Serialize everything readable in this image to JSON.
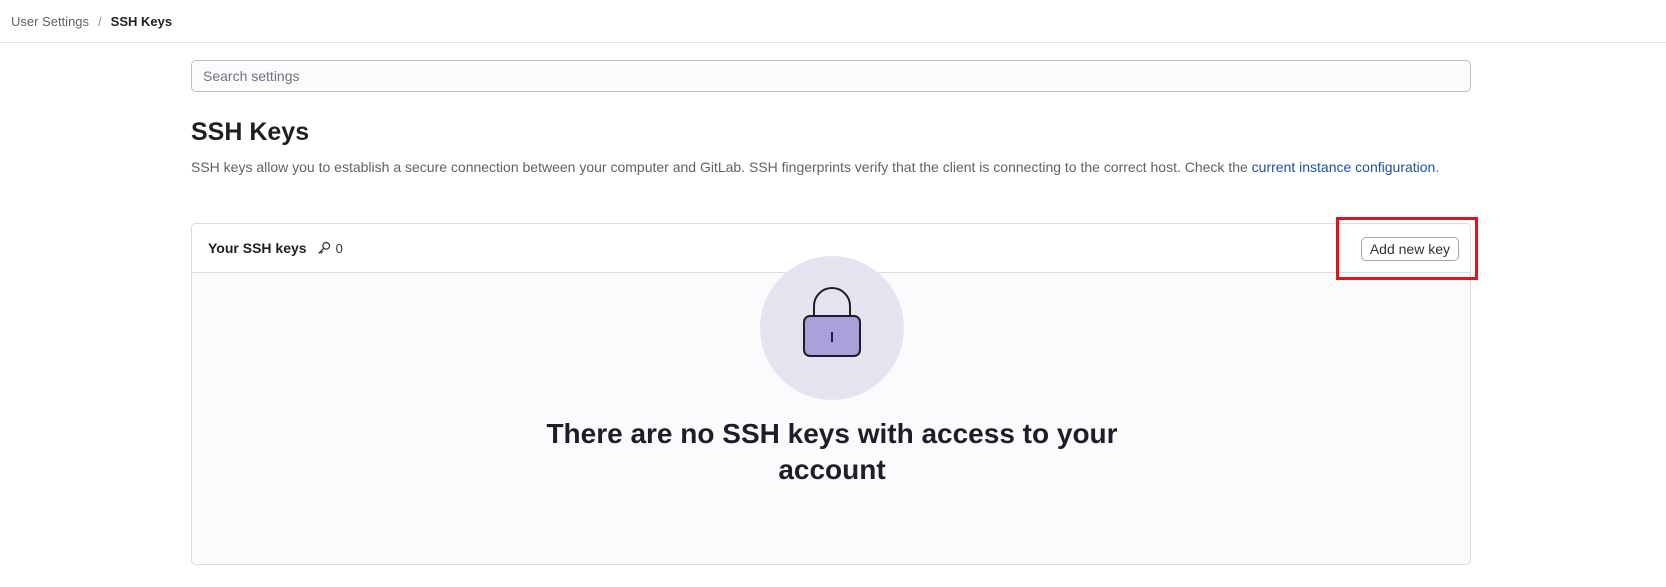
{
  "breadcrumb": {
    "parent": "User Settings",
    "separator": "/",
    "current": "SSH Keys"
  },
  "search": {
    "placeholder": "Search settings",
    "value": ""
  },
  "page": {
    "title": "SSH Keys",
    "description": "SSH keys allow you to establish a secure connection between your computer and GitLab. SSH fingerprints verify that the client is connecting to the correct host. Check the ",
    "link_text": "current instance configuration",
    "description_end": "."
  },
  "card": {
    "title": "Your SSH keys",
    "count_icon": "key-icon",
    "count": "0",
    "add_button": "Add new key",
    "empty_icon": "padlock-icon",
    "empty_message": "There are no SSH keys with access to your account"
  },
  "colors": {
    "link": "#1f4fa8",
    "highlight": "#e4131a",
    "illustration_bg": "#e6e3f1",
    "lock_body": "#ab9fdc"
  }
}
